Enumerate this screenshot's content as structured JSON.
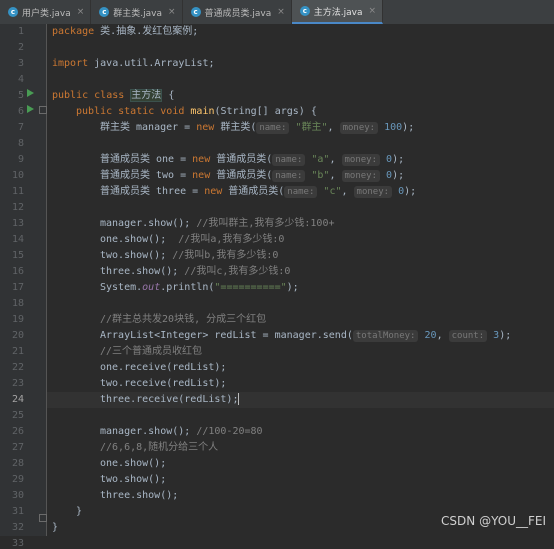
{
  "tabs": [
    {
      "label": "用户类.java",
      "active": false
    },
    {
      "label": "群主类.java",
      "active": false
    },
    {
      "label": "普通成员类.java",
      "active": false
    },
    {
      "label": "主方法.java",
      "active": true
    }
  ],
  "tab_icon_letter": "c",
  "current_line": 24,
  "watermark": "CSDN @YOU__FEI",
  "code": {
    "l1_pkg": "package",
    "l1_rest": " 类.抽象.发红包案例;",
    "l3_imp": "import",
    "l3_rest": " java.util.ArrayList;",
    "l5_public": "public",
    "l5_class": "class",
    "l5_name": "主方法",
    "l5_brace": " {",
    "l6_mods": "public static void",
    "l6_main": "main",
    "l6_rest": "(String[] args) {",
    "l7_a": "群主类 manager = ",
    "l7_new": "new",
    "l7_b": " 群主类(",
    "l7_hint1": "name:",
    "l7_str": "\"群主\"",
    "l7_c": ", ",
    "l7_hint2": "money:",
    "l7_num": "100",
    "l7_end": ");",
    "l9_a": "普通成员类 one = ",
    "l9_new": "new",
    "l9_b": " 普通成员类(",
    "l9_hint1": "name:",
    "l9_str": "\"a\"",
    "l9_c": ", ",
    "l9_hint2": "money:",
    "l9_num": "0",
    "l9_end": ");",
    "l10_a": "普通成员类 two = ",
    "l10_new": "new",
    "l10_b": " 普通成员类(",
    "l10_hint1": "name:",
    "l10_str": "\"b\"",
    "l10_c": ", ",
    "l10_hint2": "money:",
    "l10_num": "0",
    "l10_end": ");",
    "l11_a": "普通成员类 three = ",
    "l11_new": "new",
    "l11_b": " 普通成员类(",
    "l11_hint1": "name:",
    "l11_str": "\"c\"",
    "l11_c": ", ",
    "l11_hint2": "money:",
    "l11_num": "0",
    "l11_end": ");",
    "l13_code": "manager.show(); ",
    "l13_cmt": "//我叫群主,我有多少钱:100+",
    "l14_code": "one.show();  ",
    "l14_cmt": "//我叫a,我有多少钱:0",
    "l15_code": "two.show(); ",
    "l15_cmt": "//我叫b,我有多少钱:0",
    "l16_code": "three.show(); ",
    "l16_cmt": "//我叫c,我有多少钱:0",
    "l17_a": "System.",
    "l17_out": "out",
    "l17_b": ".println(",
    "l17_str": "\"==========\"",
    "l17_end": ");",
    "l19_cmt": "//群主总共发20块钱, 分成三个红包",
    "l20_a": "ArrayList<Integer> redList = manager.send(",
    "l20_hint1": "totalMoney:",
    "l20_num1": "20",
    "l20_c": ", ",
    "l20_hint2": "count:",
    "l20_num2": "3",
    "l20_end": ");",
    "l21_cmt": "//三个普通成员收红包",
    "l22_code": "one.receive(redList);",
    "l23_code": "two.receive(redList);",
    "l24_code": "three.receive(redList);",
    "l26_code": "manager.show(); ",
    "l26_cmt": "//100-20=80",
    "l27_cmt": "//6,6,8,随机分给三个人",
    "l28_code": "one.show();",
    "l29_code": "two.show();",
    "l30_code": "three.show();",
    "l31_code": "}",
    "l32_code": "}"
  }
}
